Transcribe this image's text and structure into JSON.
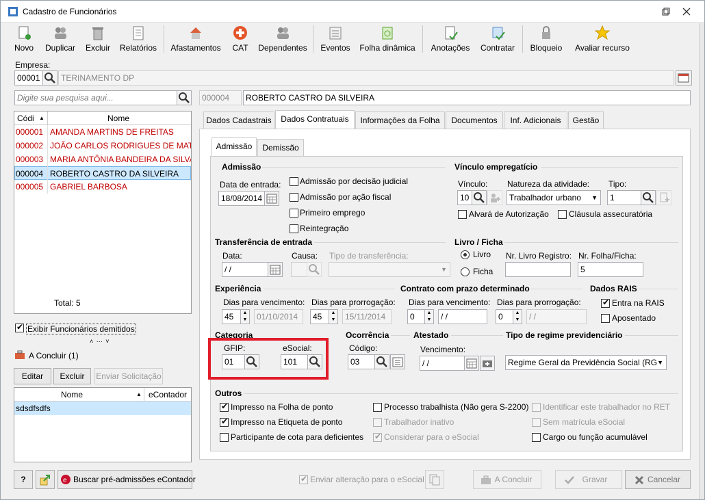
{
  "window": {
    "title": "Cadastro de Funcionários"
  },
  "toolbar": {
    "novo": "Novo",
    "duplicar": "Duplicar",
    "excluir": "Excluir",
    "relatorios": "Relatórios",
    "afastamentos": "Afastamentos",
    "cat": "CAT",
    "dependentes": "Dependentes",
    "eventos": "Eventos",
    "folha_dinamica": "Folha dinâmica",
    "anotacoes": "Anotações",
    "contratar": "Contratar",
    "bloqueio": "Bloqueio",
    "avaliar": "Avaliar recurso"
  },
  "empresa": {
    "label": "Empresa:",
    "code": "00001",
    "name": "TERINAMENTO DP"
  },
  "search": {
    "placeholder": "Digite sua pesquisa aqui..."
  },
  "employee": {
    "code": "000004",
    "name": "ROBERTO CASTRO DA SILVEIRA"
  },
  "list": {
    "col_code": "Códi",
    "col_name": "Nome",
    "rows": [
      {
        "code": "000001",
        "name": "AMANDA MARTINS DE FREITAS"
      },
      {
        "code": "000002",
        "name": "JOÃO CARLOS RODRIGUES DE MATTOS"
      },
      {
        "code": "000003",
        "name": "MARIA ANTÔNIA BANDEIRA DA SILVA"
      },
      {
        "code": "000004",
        "name": "ROBERTO CASTRO DA SILVEIRA"
      },
      {
        "code": "000005",
        "name": "GABRIEL BARBOSA"
      }
    ],
    "total": "Total: 5"
  },
  "exibir_demitidos": "Exibir Funcionários demitidos",
  "aconcluir": {
    "title": "A Concluir (1)",
    "editar": "Editar",
    "excluir": "Excluir",
    "enviar": "Enviar Solicitação",
    "col_nome": "Nome",
    "col_econtador": "eContador",
    "rows": [
      {
        "nome": "sdsdfsdfs",
        "econtador": ""
      }
    ]
  },
  "bottom_left": {
    "buscar": "Buscar pré-admissões eContador"
  },
  "tabs": [
    "Dados Cadastrais",
    "Dados Contratuais",
    "Informações da Folha",
    "Documentos",
    "Inf. Adicionais",
    "Gestão"
  ],
  "subtabs": [
    "Admissão",
    "Demissão"
  ],
  "admissao": {
    "title": "Admissão",
    "data_label": "Data de entrada:",
    "data_value": "18/08/2014",
    "cb1": "Admissão por decisão judicial",
    "cb2": "Admissão por ação fiscal",
    "cb3": "Primeiro emprego",
    "cb4": "Reintegração"
  },
  "vinculo": {
    "title": "Vínculo empregatício",
    "vinculo_label": "Vínculo:",
    "vinculo_value": "10",
    "natureza_label": "Natureza da atividade:",
    "natureza_value": "Trabalhador urbano",
    "tipo_label": "Tipo:",
    "tipo_value": "1",
    "alvara": "Alvará de Autorização",
    "clausula": "Cláusula assecuratória"
  },
  "transferencia": {
    "title": "Transferência de entrada",
    "data_label": "Data:",
    "data_value": " /  /",
    "causa_label": "Causa:",
    "tipo_label": "Tipo de transferência:"
  },
  "livro": {
    "title": "Livro / Ficha",
    "livro": "Livro",
    "ficha": "Ficha",
    "nr_livro_label": "Nr. Livro Registro:",
    "nr_folha_label": "Nr. Folha/Ficha:",
    "nr_folha_value": "5"
  },
  "experiencia": {
    "title": "Experiência",
    "venc_label": "Dias para vencimento:",
    "venc_days": "45",
    "venc_date": "01/10/2014",
    "prorr_label": "Dias para prorrogação:",
    "prorr_days": "45",
    "prorr_date": "15/11/2014"
  },
  "contrato": {
    "title": "Contrato com prazo determinado",
    "venc_label": "Dias para vencimento:",
    "venc_days": "0",
    "venc_date": " /  /",
    "prorr_label": "Dias para prorrogação:",
    "prorr_days": "0",
    "prorr_date": " /  /"
  },
  "rais": {
    "title": "Dados RAIS",
    "entra": "Entra na RAIS",
    "aposentado": "Aposentado"
  },
  "categoria": {
    "title": "Categoria",
    "gfip_label": "GFIP:",
    "gfip_value": "01",
    "esocial_label": "eSocial:",
    "esocial_value": "101"
  },
  "ocorrencia": {
    "title": "Ocorrência",
    "codigo_label": "Código:",
    "codigo_value": "03"
  },
  "atestado": {
    "title": "Atestado",
    "venc_label": "Vencimento:",
    "venc_value": " /  /"
  },
  "regime": {
    "title": "Tipo de regime previdenciário",
    "value": "Regime Geral da Previdência Social (RGP"
  },
  "outros": {
    "title": "Outros",
    "c1": "Impresso na Folha de ponto",
    "c2": "Impresso na Etiqueta de ponto",
    "c3": "Participante de cota para deficientes",
    "c4": "Processo trabalhista (Não gera S-2200)",
    "c5": "Trabalhador inativo",
    "c6": "Considerar para o eSocial",
    "c7": "Identificar este trabalhador no RET",
    "c8": "Sem matrícula eSocial",
    "c9": "Cargo ou função acumulável"
  },
  "footer": {
    "enviar_alt": "Enviar alteração para o eSocial",
    "aconcluir": "A Concluir",
    "gravar": "Gravar",
    "cancelar": "Cancelar"
  },
  "colors": {
    "accent_red": "#e11d2a",
    "selected_row": "#cce8ff",
    "list_text": "#c00000"
  }
}
